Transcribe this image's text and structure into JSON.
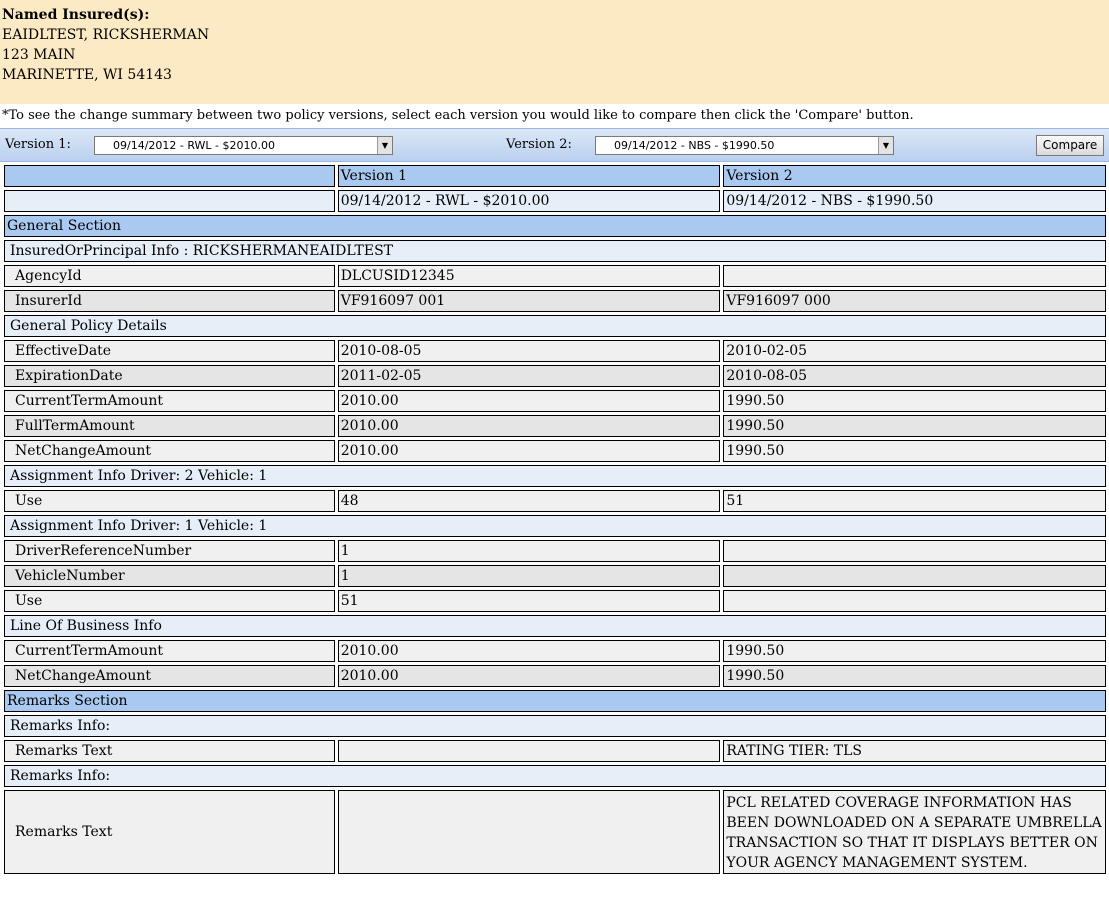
{
  "insured": {
    "heading": "Named Insured(s):",
    "name": "EAIDLTEST, RICKSHERMAN",
    "address1": "123 MAIN",
    "address2": "MARINETTE, WI 54143"
  },
  "instructions": "*To see the change summary between two policy versions, select each version you would like to compare then click the 'Compare' button.",
  "selector": {
    "version1_label": "Version 1:",
    "version1_value": "09/14/2012 - RWL - $2010.00",
    "version2_label": "Version 2:",
    "version2_value": "09/14/2012 - NBS - $1990.50",
    "compare_label": "Compare"
  },
  "table": {
    "header": [
      "",
      "Version 1",
      "Version 2"
    ],
    "versions": [
      "",
      "09/14/2012 - RWL - $2010.00",
      "09/14/2012 - NBS - $1990.50"
    ],
    "sections": {
      "general": "General Section",
      "insured_info": "InsuredOrPrincipal Info : RICKSHERMANEAIDLTEST",
      "agency_id": [
        "AgencyId",
        "DLCUSID12345",
        ""
      ],
      "insurer_id": [
        "InsurerId",
        "VF916097 001",
        "VF916097 000"
      ],
      "policy_details": "General Policy Details",
      "effective_date": [
        "EffectiveDate",
        "2010-08-05",
        "2010-02-05"
      ],
      "expiration_date": [
        "ExpirationDate",
        "2011-02-05",
        "2010-08-05"
      ],
      "current_term": [
        "CurrentTermAmount",
        "2010.00",
        "1990.50"
      ],
      "full_term": [
        "FullTermAmount",
        "2010.00",
        "1990.50"
      ],
      "net_change": [
        "NetChangeAmount",
        "2010.00",
        "1990.50"
      ],
      "assign_d2v1": "Assignment Info Driver: 2 Vehicle: 1",
      "use_d2v1": [
        "Use",
        "48",
        "51"
      ],
      "assign_d1v1": "Assignment Info Driver: 1 Vehicle: 1",
      "driver_ref": [
        "DriverReferenceNumber",
        "1",
        ""
      ],
      "vehicle_num": [
        "VehicleNumber",
        "1",
        ""
      ],
      "use_d1v1": [
        "Use",
        "51",
        ""
      ],
      "lob_info": "Line Of Business Info",
      "lob_current_term": [
        "CurrentTermAmount",
        "2010.00",
        "1990.50"
      ],
      "lob_net_change": [
        "NetChangeAmount",
        "2010.00",
        "1990.50"
      ],
      "remarks": "Remarks Section",
      "remarks_info_1": "Remarks Info:",
      "remarks_text_1": [
        "Remarks Text",
        "",
        "RATING TIER: TLS"
      ],
      "remarks_info_2": "Remarks Info:",
      "remarks_text_2": [
        "Remarks Text",
        "",
        "PCL RELATED COVERAGE INFORMATION HAS BEEN DOWNLOADED ON A SEPARATE UMBRELLA TRANSACTION SO THAT IT DISPLAYS BETTER ON YOUR AGENCY MANAGEMENT SYSTEM."
      ]
    }
  }
}
